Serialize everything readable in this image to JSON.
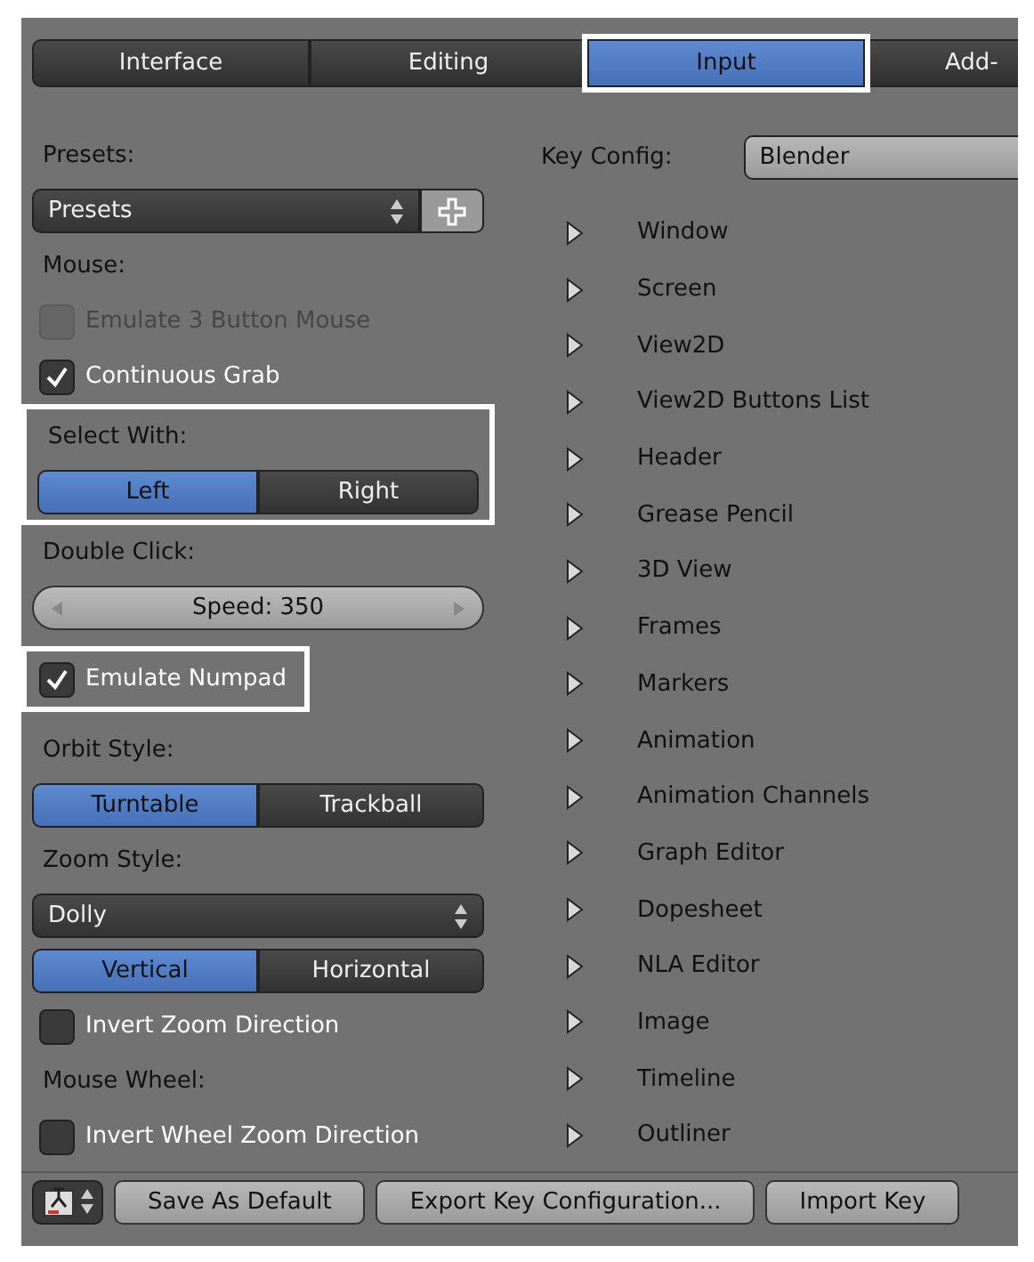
{
  "tabs": [
    {
      "label": "Interface",
      "selected": false,
      "highlighted": false
    },
    {
      "label": "Editing",
      "selected": false,
      "highlighted": false
    },
    {
      "label": "Input",
      "selected": true,
      "highlighted": true
    },
    {
      "label": "Add-",
      "selected": false,
      "highlighted": false
    }
  ],
  "left_panel": [
    {
      "kind": "label",
      "text": "Presets:"
    },
    {
      "kind": "preset",
      "value": "Presets"
    },
    {
      "kind": "label",
      "text": "Mouse:"
    },
    {
      "kind": "checkbox",
      "text": "Emulate 3 Button Mouse",
      "checked": false,
      "disabled": true
    },
    {
      "kind": "checkbox",
      "text": "Continuous Grab",
      "checked": true,
      "disabled": false
    },
    {
      "kind": "group",
      "highlighted": true,
      "items": [
        {
          "kind": "label",
          "text": "Select With:"
        },
        {
          "kind": "toggle",
          "options": [
            {
              "label": "Left",
              "selected": true
            },
            {
              "label": "Right",
              "selected": false
            }
          ]
        }
      ]
    },
    {
      "kind": "label",
      "text": "Double Click:"
    },
    {
      "kind": "slider",
      "value": "Speed: 350"
    },
    {
      "kind": "group",
      "highlighted": true,
      "items": [
        {
          "kind": "checkbox",
          "text": "Emulate Numpad",
          "checked": true,
          "disabled": false
        }
      ]
    },
    {
      "kind": "label",
      "text": "Orbit Style:"
    },
    {
      "kind": "toggle",
      "options": [
        {
          "label": "Turntable",
          "selected": true
        },
        {
          "label": "Trackball",
          "selected": false
        }
      ]
    },
    {
      "kind": "label",
      "text": "Zoom Style:"
    },
    {
      "kind": "dropdown",
      "value": "Dolly"
    },
    {
      "kind": "toggle",
      "options": [
        {
          "label": "Vertical",
          "selected": true
        },
        {
          "label": "Horizontal",
          "selected": false
        }
      ]
    },
    {
      "kind": "checkbox",
      "text": "Invert Zoom Direction",
      "checked": false,
      "disabled": false
    },
    {
      "kind": "label",
      "text": "Mouse Wheel:"
    },
    {
      "kind": "checkbox",
      "text": "Invert Wheel Zoom Direction",
      "checked": false,
      "disabled": false
    }
  ],
  "key_config": {
    "label": "Key Config:",
    "value": "Blender",
    "items": [
      {
        "label": "Window",
        "expanded": false
      },
      {
        "label": "Screen",
        "expanded": false
      },
      {
        "label": "View2D",
        "expanded": false
      },
      {
        "label": "View2D Buttons List",
        "expanded": false
      },
      {
        "label": "Header",
        "expanded": false
      },
      {
        "label": "Grease Pencil",
        "expanded": false
      },
      {
        "label": "3D View",
        "expanded": false
      },
      {
        "label": "Frames",
        "expanded": false
      },
      {
        "label": "Markers",
        "expanded": false
      },
      {
        "label": "Animation",
        "expanded": false
      },
      {
        "label": "Animation Channels",
        "expanded": false
      },
      {
        "label": "Graph Editor",
        "expanded": false
      },
      {
        "label": "Dopesheet",
        "expanded": false
      },
      {
        "label": "NLA Editor",
        "expanded": false
      },
      {
        "label": "Image",
        "expanded": false
      },
      {
        "label": "Timeline",
        "expanded": false
      },
      {
        "label": "Outliner",
        "expanded": false
      }
    ]
  },
  "footer": {
    "buttons": [
      "Save As Default",
      "Export Key Configuration...",
      "Import Key"
    ]
  }
}
